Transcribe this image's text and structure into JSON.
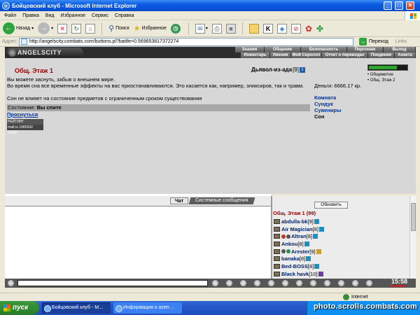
{
  "window": {
    "title": "Бойцовский клуб - Microsoft Internet Explorer",
    "controls": [
      "minimize",
      "maximize",
      "close"
    ]
  },
  "menu": [
    "Файл",
    "Правка",
    "Вид",
    "Избранное",
    "Сервис",
    "Справка"
  ],
  "toolbar": {
    "back_label": "Назад",
    "search_label": "Поиск",
    "favorites_label": "Избранное"
  },
  "address": {
    "label": "Адрес:",
    "url": "http://angelscity.combats.com/buttons.pl?battle=0.569653817372274",
    "go_label": "Переход",
    "links_label": "Links"
  },
  "game": {
    "logo": "ANGELSCITY",
    "nav_top": [
      "Знания",
      "Общение",
      "Безопасность",
      "Персонаж",
      "Выход"
    ],
    "nav_bottom": [
      "Инвентарь",
      "Умения",
      "Мой Скроллл",
      "Отчет о переводах",
      "Поединки",
      "Анкета"
    ],
    "location_title": "Общ. Этаж 1",
    "enemy": {
      "name": "Дьявол-из-ада",
      "level": "[9]"
    },
    "messages": [
      "Вы можете заснуть, забыв о внешнем мире.",
      "Во время сна все временные эффекты на вас приостанавливаются. Это касается как, например, эликсиров, так и травм.",
      "Сон не влияет на состояние предметов с ограниченным сроком существования"
    ],
    "money": "Деньги: 6666.17 кр.",
    "state_label": "Состояние:",
    "state_value": "Вы спите",
    "wake_link": "Проснуться",
    "counters": [
      {
        "label": "РЕЙТИНГ",
        "value": "1945763437"
      },
      {
        "label": "mail.ru",
        "value": "1482642 32495"
      }
    ],
    "side_links": [
      "Комната",
      "Сундук",
      "Сувениры",
      "Сон"
    ],
    "right_links": [
      "Общежитие",
      "Общ. Этаж 2"
    ]
  },
  "chat": {
    "tabs": [
      "Чат",
      "Системные сообщения"
    ]
  },
  "players": {
    "refresh_label": "Обновить",
    "title": "Общ. Этаж 1 (99)",
    "list": [
      {
        "name": "abdulla-bk",
        "level": "[9]",
        "color": "#1f8fc0"
      },
      {
        "name": "Air Magician",
        "level": "[8]",
        "color": "#1f8fc0"
      },
      {
        "name": "Altran",
        "level": "[8]",
        "color": "#1f8fc0"
      },
      {
        "name": "Ankou",
        "level": "[8]",
        "color": "#1f8fc0"
      },
      {
        "name": "Arester",
        "level": "[9]",
        "color": "#c8a030"
      },
      {
        "name": "banaka",
        "level": "[8]",
        "color": "#1f8fc0"
      },
      {
        "name": "Bed-BOSS",
        "level": "[8]",
        "color": "#1f8fc0"
      },
      {
        "name": "Black havk",
        "level": "[10]",
        "color": "#6a3fa0"
      }
    ]
  },
  "chatbar": {
    "clock": "15:58"
  },
  "statusbar": {
    "zone": "Internet"
  },
  "taskbar": {
    "start_label": "пуск",
    "tasks": [
      "Бойцовский клуб - M...",
      "Информация о azen ..."
    ]
  },
  "watermark": "photo.scrolls.combats.com"
}
